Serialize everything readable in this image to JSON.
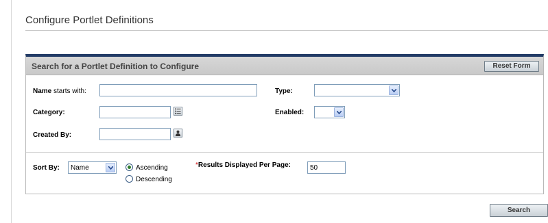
{
  "page": {
    "title": "Configure Portlet Definitions"
  },
  "panel": {
    "title": "Search for a Portlet Definition to Configure",
    "reset_label": "Reset Form"
  },
  "fields": {
    "name": {
      "label_bold": "Name",
      "label_rest": " starts with:",
      "value": ""
    },
    "type": {
      "label": "Type:",
      "value": ""
    },
    "category": {
      "label": "Category:",
      "value": ""
    },
    "enabled": {
      "label": "Enabled:",
      "value": ""
    },
    "created_by": {
      "label": "Created By:",
      "value": ""
    }
  },
  "sort": {
    "label": "Sort By:",
    "value": "Name",
    "ascending_label": "Ascending",
    "descending_label": "Descending",
    "selected": "ascending"
  },
  "results": {
    "required_mark": "*",
    "label": "Results Displayed Per Page:",
    "value": "50"
  },
  "actions": {
    "search_label": "Search"
  },
  "icons": {
    "type_dropdown": "chevron-down-icon",
    "enabled_dropdown": "chevron-down-icon",
    "sort_dropdown": "chevron-down-icon",
    "category_picker": "list-icon",
    "user_picker": "user-icon"
  },
  "colors": {
    "panel_accent": "#223b66",
    "header_bg": "#d0d0d0"
  }
}
